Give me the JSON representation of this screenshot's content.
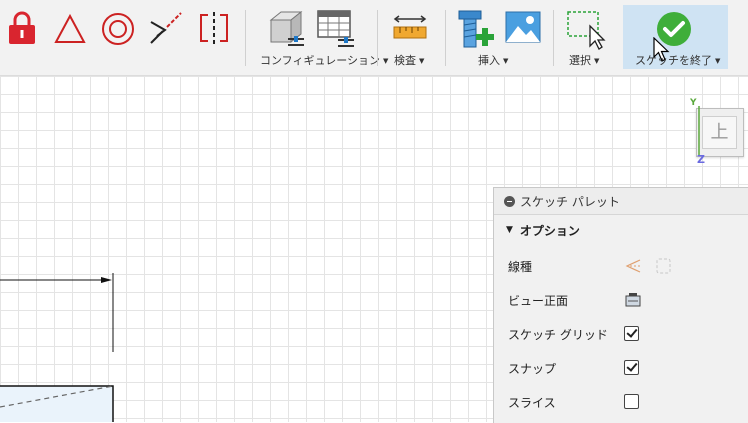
{
  "toolbar": {
    "groups": [
      {
        "label": "コンフィギュレーション"
      },
      {
        "label": "検査"
      },
      {
        "label": "挿入"
      },
      {
        "label": "選択"
      },
      {
        "label": "スケッチを終了"
      }
    ],
    "icons": [
      "lock-icon",
      "triangle-icon",
      "circle-icon",
      "trim-icon",
      "mirror-icon",
      "configure-table-icon",
      "configure-grid-icon",
      "measure-icon",
      "insert-bolt-icon",
      "insert-image-icon",
      "select-box-icon",
      "finish-sketch-icon"
    ]
  },
  "viewcube": {
    "face": "上",
    "axis_y": "Y",
    "axis_z": "Z"
  },
  "palette": {
    "title": "スケッチ パレット",
    "section": "オプション",
    "rows": [
      {
        "label": "線種",
        "control": "linetype-icons"
      },
      {
        "label": "ビュー正面",
        "control": "look-at-icon"
      },
      {
        "label": "スケッチ グリッド",
        "control": "checkbox",
        "checked": true
      },
      {
        "label": "スナップ",
        "control": "checkbox",
        "checked": true
      },
      {
        "label": "スライス",
        "control": "checkbox",
        "checked": false
      }
    ]
  },
  "colors": {
    "accent_red": "#d9252f",
    "finish_green": "#3fae3a",
    "highlight": "#cfe3f3",
    "axis_y": "#5aa83c",
    "axis_z": "#6a6ae0"
  }
}
